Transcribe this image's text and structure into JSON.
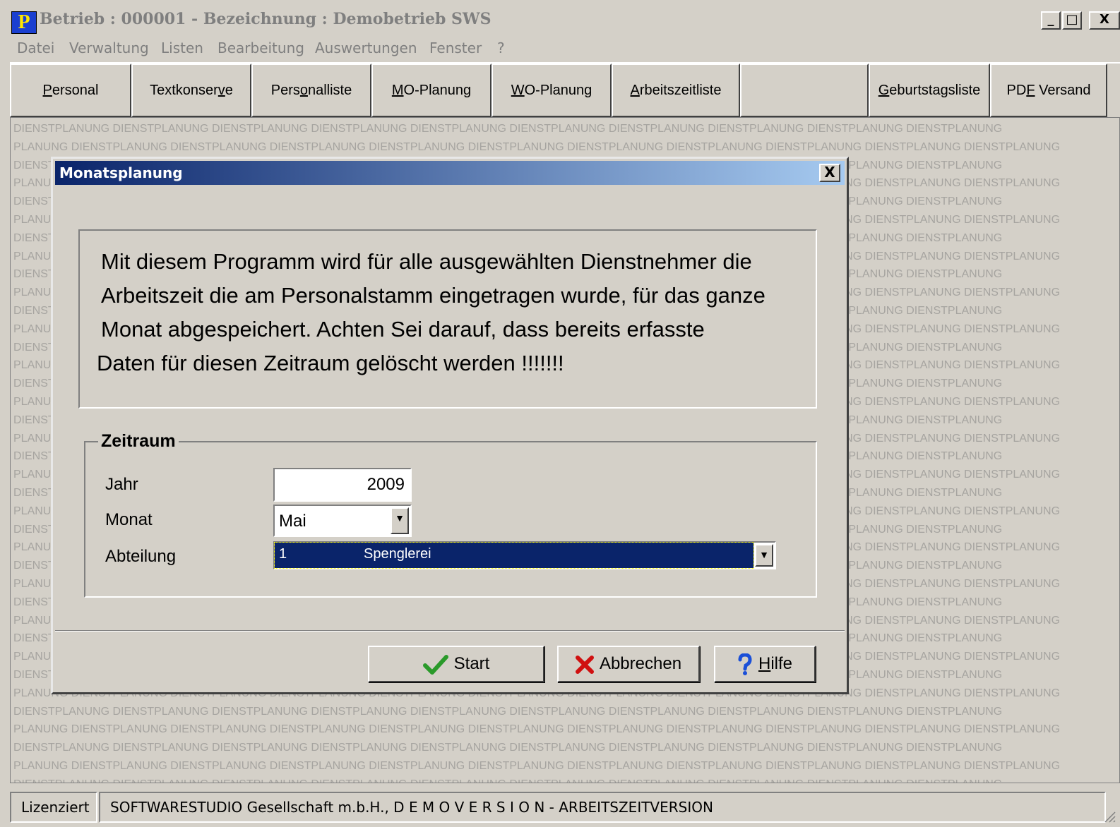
{
  "window": {
    "title": "Betrieb : 000001 - Bezeichnung : Demobetrieb SWS",
    "app_icon_letter": "P",
    "minimize": "_",
    "maximize": "□",
    "close": "X"
  },
  "menu": [
    "Datei",
    "Verwaltung",
    "Listen",
    "Bearbeitung",
    "Auswertungen",
    "Fenster",
    "?"
  ],
  "toolbar": [
    {
      "label": "Personal",
      "mnemonic": "P",
      "rest": "ersonal",
      "pre": ""
    },
    {
      "label": "Textkonserve",
      "pre": "Textkonser",
      "mnemonic": "v",
      "rest": "e"
    },
    {
      "label": "Personalliste",
      "pre": "Pers",
      "mnemonic": "o",
      "rest": "nalliste"
    },
    {
      "label": "MO-Planung",
      "pre": "",
      "mnemonic": "M",
      "rest": "O-Planung"
    },
    {
      "label": "WO-Planung",
      "pre": "",
      "mnemonic": "W",
      "rest": "O-Planung"
    },
    {
      "label": "Arbeitszeitliste",
      "pre": "",
      "mnemonic": "A",
      "rest": "rbeitszeitliste"
    },
    {
      "label": "",
      "pre": "",
      "mnemonic": "",
      "rest": ""
    },
    {
      "label": "Geburtstagsliste",
      "pre": "",
      "mnemonic": "G",
      "rest": "eburtstagsliste"
    },
    {
      "label": "PDF Versand",
      "pre": "PD",
      "mnemonic": "F",
      "rest": " Versand"
    }
  ],
  "watermark": {
    "row_a": "DIENSTPLANUNG DIENSTPLANUNG DIENSTPLANUNG DIENSTPLANUNG DIENSTPLANUNG DIENSTPLANUNG DIENSTPLANUNG DIENSTPLANUNG DIENSTPLANUNG DIENSTPLANUNG",
    "row_b": "PLANUNG DIENSTPLANUNG DIENSTPLANUNG DIENSTPLANUNG DIENSTPLANUNG DIENSTPLANUNG DIENSTPLANUNG DIENSTPLANUNG DIENSTPLANUNG DIENSTPLANUNG DIENSTPLANUNG"
  },
  "dialog": {
    "title": "Monatsplanung",
    "close": "X",
    "message": [
      "Mit diesem Programm wird für alle ausgewählten Dienstnehmer die",
      "Arbeitszeit die am Personalstamm eingetragen wurde, für das ganze",
      "Monat abgespeichert. Achten Sei darauf, dass bereits erfasste",
      "Daten für diesen Zeitraum gelöscht werden !!!!!!!"
    ],
    "group_label": "Zeitraum",
    "fields": {
      "jahr_label": "Jahr",
      "jahr_value": "2009",
      "monat_label": "Monat",
      "monat_value": "Mai",
      "abteilung_label": "Abteilung",
      "abteilung_code": "1",
      "abteilung_name": "Spenglerei"
    },
    "buttons": {
      "start": "Start",
      "abbrechen": "Abbrechen",
      "hilfe_mnemonic": "H",
      "hilfe_rest": "ilfe"
    },
    "icons": {
      "start": "check-icon",
      "abbrechen": "x-icon",
      "hilfe": "question-icon"
    },
    "colors": {
      "start_icon": "#2a9a2a",
      "abbrechen_icon": "#d01010",
      "hilfe_icon": "#1a4fd8",
      "selection": "#0a246a"
    }
  },
  "status": {
    "left": "Lizenziert",
    "right": "SOFTWARESTUDIO Gesellschaft m.b.H., D E M O V E R S I O N - ARBEITSZEITVERSION"
  }
}
